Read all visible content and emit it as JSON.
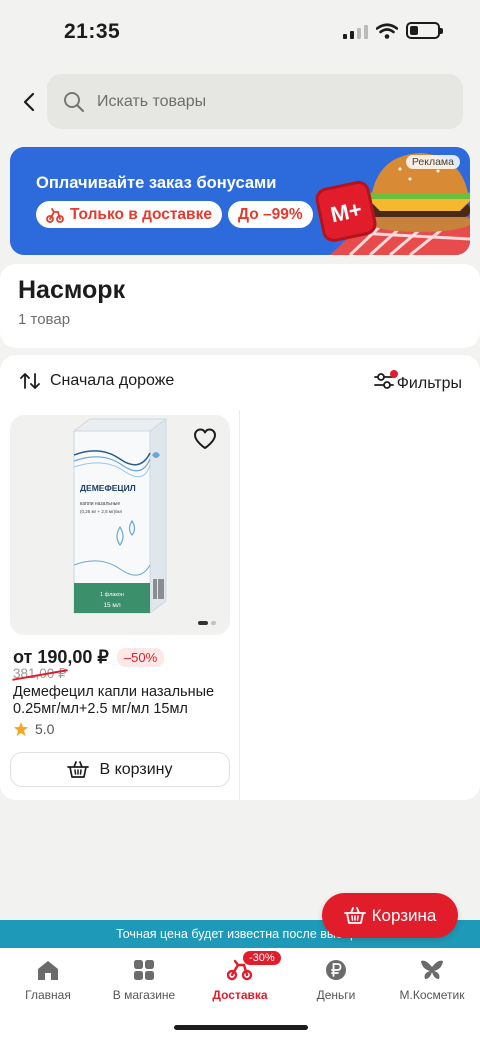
{
  "status_bar": {
    "time": "21:35"
  },
  "search": {
    "placeholder": "Искать товары"
  },
  "banner": {
    "title": "Оплачивайте заказ бонусами",
    "pill_delivery": "Только в доставке",
    "pill_discount": "До –99%",
    "ad_label": "Реклама",
    "logo_text": "M+"
  },
  "category": {
    "title": "Насморк",
    "count": "1 товар"
  },
  "controls": {
    "sort_label": "Сначала дороже",
    "filter_label": "Фильтры"
  },
  "product": {
    "box_name": "ДЕМЕФЕЦИЛ",
    "box_sub": "капли назальные",
    "box_dose": "(0,25 мг + 2,5 мг)/мл",
    "box_vial": "1 флакон",
    "box_volume": "15 мл",
    "price": "от 190,00 ₽",
    "discount": "–50%",
    "old_price": "381,00 ₽",
    "name": "Демефецил капли назальные 0.25мг/мл+2.5 мг/мл 15мл",
    "rating": "5.0",
    "cart_label": "В корзину",
    "image_count": 2,
    "image_active": 1
  },
  "floating_cart": {
    "label": "Корзина"
  },
  "info_strip": {
    "text": "Точная цена будет известна после выбора"
  },
  "tabs": [
    {
      "label": "Главная",
      "icon": "home-icon"
    },
    {
      "label": "В магазине",
      "icon": "grid-icon"
    },
    {
      "label": "Доставка",
      "icon": "scooter-icon",
      "badge": "-30%",
      "active": true
    },
    {
      "label": "Деньги",
      "icon": "ruble-icon"
    },
    {
      "label": "М.Косметик",
      "icon": "butterfly-icon"
    }
  ],
  "colors": {
    "accent": "#e11d2b",
    "banner": "#2d6bdd",
    "info_strip": "#1e9ab8",
    "box_green": "#3b8f6b"
  }
}
